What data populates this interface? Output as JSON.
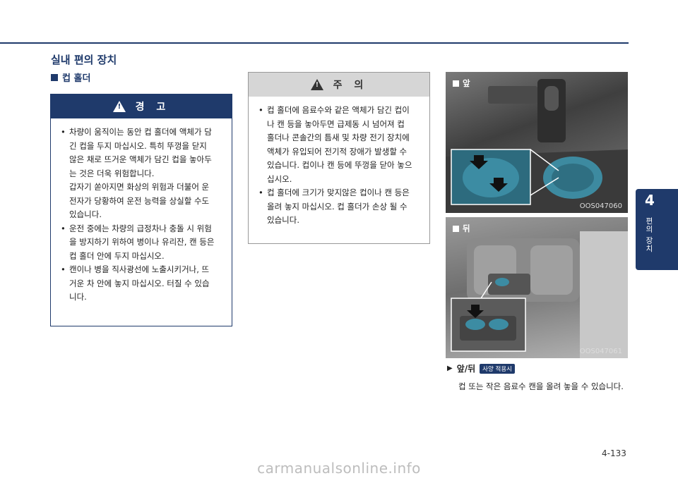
{
  "section_title": "실내 편의 장치",
  "sub_title": "컵 홀더",
  "warning": {
    "title": "경 고",
    "items": [
      [
        "차량이 움직이는 동안 컵 홀더에 액체가 담",
        "긴 컵을 두지 마십시오. 특히 뚜껑을 닫지",
        "않은 채로 뜨거운 액체가 담긴 컵을 놓아두",
        "는 것은 더욱 위험합니다.",
        "갑자기 쏟아지면 화상의 위험과 더불어 운",
        "전자가 당황하여 운전 능력을 상실할 수도",
        "있습니다."
      ],
      [
        "운전 중에는 차량의 급정차나 충돌 시 위험",
        "을 방지하기 위하여 병이나 유리잔, 캔 등은",
        "컵 홀더 안에 두지 마십시오."
      ],
      [
        "캔이나 병을 직사광선에 노출시키거나, 뜨",
        "거운 차 안에 놓지 마십시오. 터질 수 있습",
        "니다."
      ]
    ]
  },
  "caution": {
    "title": "주 의",
    "items": [
      [
        "컵 홀더에 음료수와 같은 액체가 담긴 컵이",
        "나 캔 등을 놓아두면 급제동 시 넘어져 컵",
        "홀더나 콘솔간의 틈새 및 차량 전기 장치에",
        "액체가 유입되어 전기적 장애가 발생할 수",
        "있습니다. 컵이나 캔 등에 뚜껑을 닫아 놓으",
        "십시오."
      ],
      [
        "컵 홀더에 크기가 맞지않은 컵이나 캔 등은",
        "올려 놓지 마십시오. 컵 홀더가 손상 될 수",
        "있습니다."
      ]
    ]
  },
  "photos": [
    {
      "label": "앞",
      "code": "OOS047060"
    },
    {
      "label": "뒤",
      "code": "OOS047061"
    }
  ],
  "feature": {
    "arrow": "▶",
    "title": "앞/뒤",
    "badge": "사양 적용시",
    "description": "컵 또는 작은 음료수 캔을 올려 놓을 수 있습니다."
  },
  "page_number": "4-133",
  "side_tab": {
    "number": "4",
    "text": "편의 장치"
  },
  "watermark": "carmanualsonline.info",
  "colors": {
    "brand_navy": "#1f3a6b",
    "caution_gray": "#d6d6d6"
  }
}
